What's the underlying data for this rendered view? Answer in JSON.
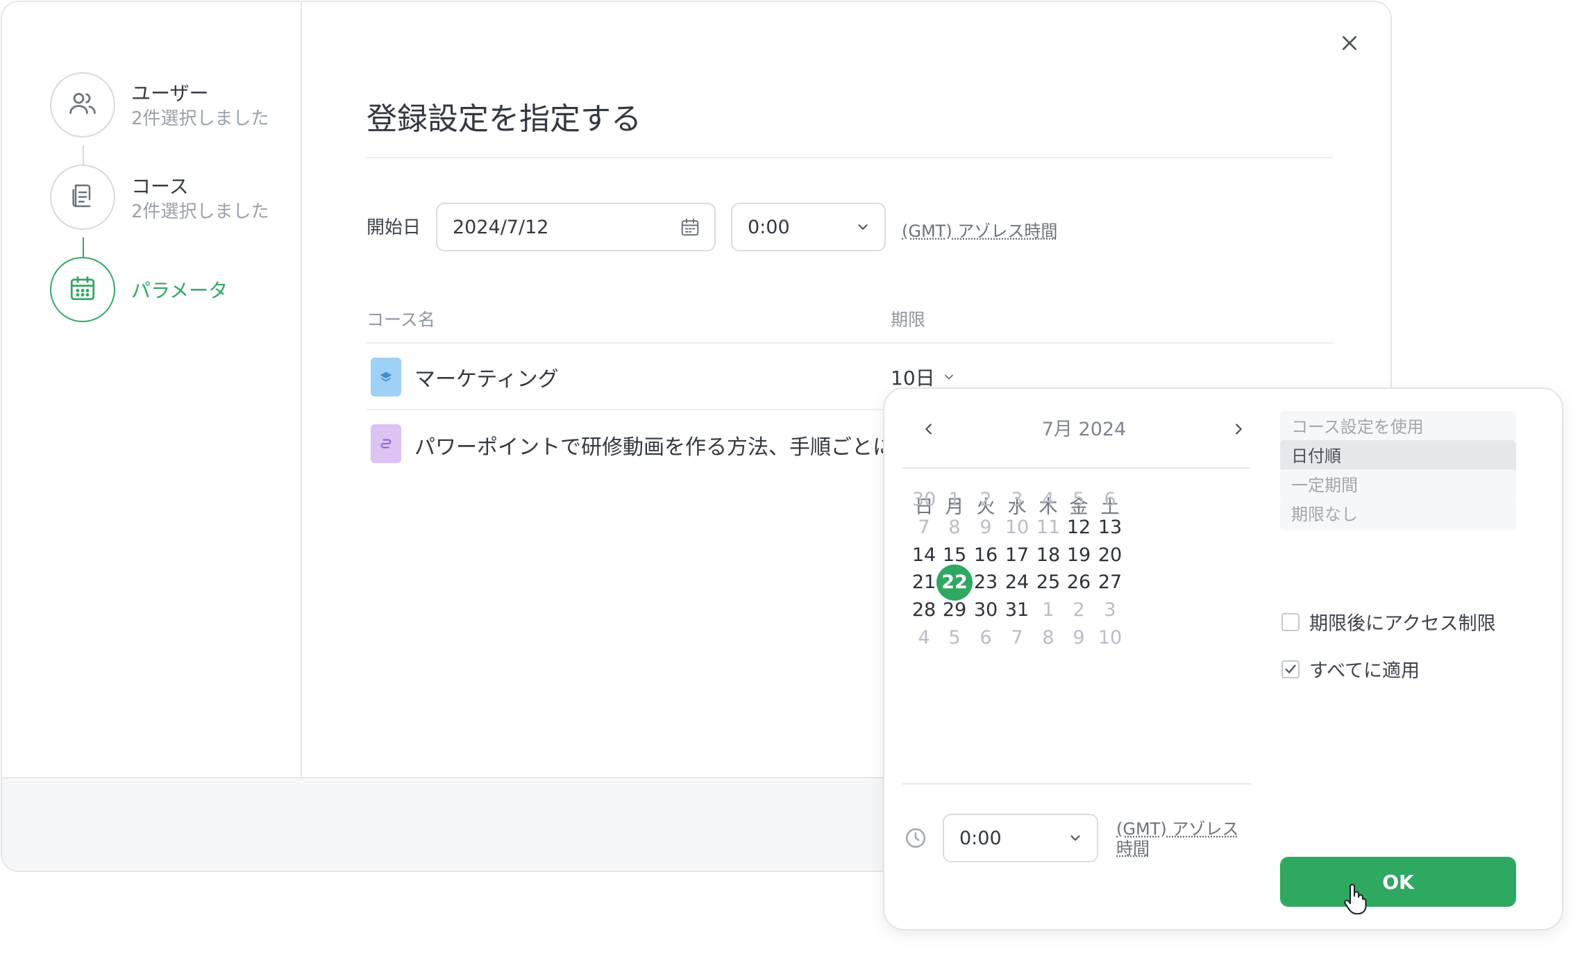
{
  "steps": [
    {
      "title": "ユーザー",
      "subtitle": "2件選択しました",
      "icon": "users-icon"
    },
    {
      "title": "コース",
      "subtitle": "2件選択しました",
      "icon": "document-icon"
    },
    {
      "title": "パラメータ",
      "icon": "calendar-icon",
      "active": true
    }
  ],
  "dialog": {
    "title": "登録設定を指定する",
    "start_date_label": "開始日",
    "start_date_value": "2024/7/12",
    "start_time_value": "0:00",
    "timezone": "(GMT) アゾレス時間"
  },
  "table": {
    "headers": {
      "course": "コース名",
      "deadline": "期限"
    },
    "rows": [
      {
        "name": "マーケティング",
        "deadline": "10日",
        "icon_color": "#9fd0f5"
      },
      {
        "name": "パワーポイントで研修動画を作る方法、手順ごとに解説",
        "icon_color": "#dcc3f3"
      }
    ]
  },
  "calendar": {
    "month_label": "7月 2024",
    "weekdays": [
      "日",
      "月",
      "火",
      "水",
      "木",
      "金",
      "土"
    ],
    "weeks": [
      [
        {
          "d": "30",
          "m": true
        },
        {
          "d": "1",
          "m": true
        },
        {
          "d": "2",
          "m": true
        },
        {
          "d": "3",
          "m": true
        },
        {
          "d": "4",
          "m": true
        },
        {
          "d": "5",
          "m": true
        },
        {
          "d": "6",
          "m": true
        }
      ],
      [
        {
          "d": "7",
          "m": true
        },
        {
          "d": "8",
          "m": true
        },
        {
          "d": "9",
          "m": true
        },
        {
          "d": "10",
          "m": true
        },
        {
          "d": "11",
          "m": true
        },
        {
          "d": "12"
        },
        {
          "d": "13"
        }
      ],
      [
        {
          "d": "14"
        },
        {
          "d": "15"
        },
        {
          "d": "16"
        },
        {
          "d": "17"
        },
        {
          "d": "18"
        },
        {
          "d": "19"
        },
        {
          "d": "20"
        }
      ],
      [
        {
          "d": "21"
        },
        {
          "d": "22",
          "s": true
        },
        {
          "d": "23"
        },
        {
          "d": "24"
        },
        {
          "d": "25"
        },
        {
          "d": "26"
        },
        {
          "d": "27"
        }
      ],
      [
        {
          "d": "28"
        },
        {
          "d": "29"
        },
        {
          "d": "30"
        },
        {
          "d": "31"
        },
        {
          "d": "1",
          "n": true
        },
        {
          "d": "2",
          "n": true
        },
        {
          "d": "3",
          "n": true
        }
      ],
      [
        {
          "d": "4",
          "n": true
        },
        {
          "d": "5",
          "n": true
        },
        {
          "d": "6",
          "n": true
        },
        {
          "d": "7",
          "n": true
        },
        {
          "d": "8",
          "n": true
        },
        {
          "d": "9",
          "n": true
        },
        {
          "d": "10",
          "n": true
        }
      ]
    ],
    "time_value": "0:00",
    "timezone": "(GMT) アゾレス時間"
  },
  "options": {
    "items": [
      "コース設定を使用",
      "日付順",
      "一定期間",
      "期限なし"
    ],
    "selected_index": 1,
    "restrict_label": "期限後にアクセス制限",
    "restrict_checked": false,
    "apply_all_label": "すべてに適用",
    "apply_all_checked": true,
    "ok_label": "OK"
  },
  "colors": {
    "accent": "#2fa862",
    "border": "#d9dce1",
    "muted_text": "#9aa1aa"
  }
}
